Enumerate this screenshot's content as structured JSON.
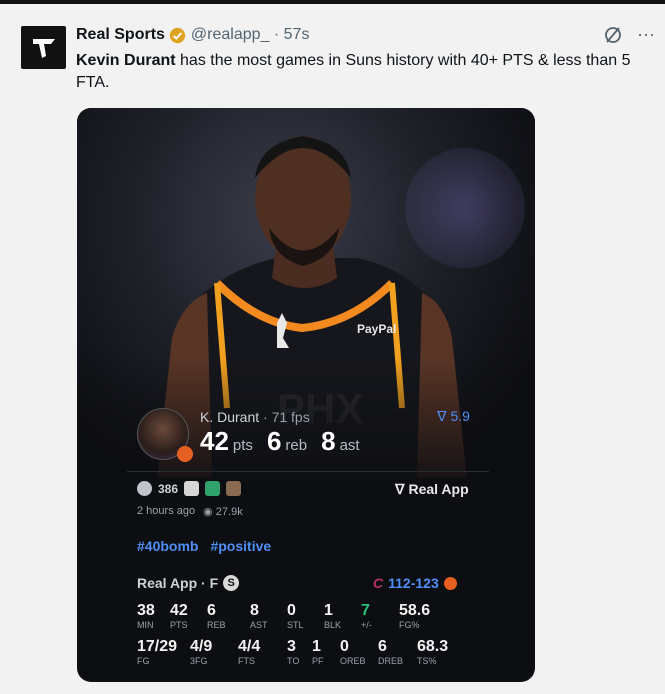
{
  "tweet": {
    "account_name": "Real Sports",
    "handle_time": "@realapp_ · 57s",
    "text_bold": "Kevin Durant",
    "text_rest": " has the most games in Suns history with 40+ PTS & less than 5 FTA."
  },
  "card": {
    "player_name": "K. Durant",
    "fps": " · 71 fps",
    "stat_pts": "42",
    "pts_unit": "pts",
    "stat_reb": "6",
    "reb_unit": "reb",
    "stat_ast": "8",
    "ast_unit": "ast",
    "rating": "5.9",
    "reaction_count": "386",
    "brand": "Real App",
    "time_ago": "2 hours ago",
    "views": "27.9k",
    "hashtags": [
      "#40bomb",
      "#positive"
    ],
    "game_label": "Real App · F",
    "s_badge": "S",
    "score": "112-123",
    "box_row1": [
      {
        "v": "38",
        "l": "MIN"
      },
      {
        "v": "42",
        "l": "PTS"
      },
      {
        "v": "6",
        "l": "REB"
      },
      {
        "v": "8",
        "l": "AST"
      },
      {
        "v": "0",
        "l": "STL"
      },
      {
        "v": "1",
        "l": "BLK"
      },
      {
        "v": "7",
        "l": "+/-"
      },
      {
        "v": "58.6",
        "l": "FG%"
      }
    ],
    "box_row2": [
      {
        "v": "17/29",
        "l": "FG"
      },
      {
        "v": "4/9",
        "l": "3FG"
      },
      {
        "v": "4/4",
        "l": "FTS"
      },
      {
        "v": "3",
        "l": "TO"
      },
      {
        "v": "1",
        "l": "PF"
      },
      {
        "v": "0",
        "l": "OREB"
      },
      {
        "v": "6",
        "l": "DREB"
      },
      {
        "v": "68.3",
        "l": "TS%"
      }
    ]
  },
  "colors": {
    "accent_blue": "#4f8ff5",
    "positive_green": "#2fc17a",
    "suns_orange": "#e56020"
  }
}
